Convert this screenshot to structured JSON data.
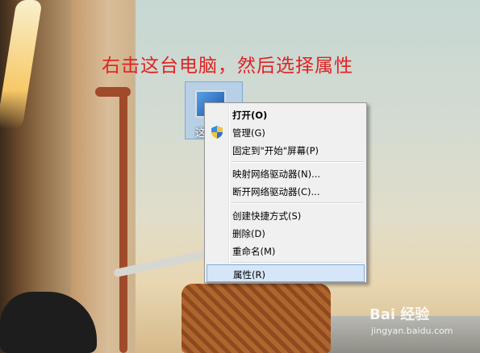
{
  "instruction": "右击这台电脑，然后选择属性",
  "desktop_icon": {
    "label": "这",
    "icon": "computer-monitor-icon"
  },
  "context_menu": {
    "items": [
      {
        "label": "打开(O)",
        "bold": true
      },
      {
        "label": "管理(G)",
        "icon": "uac-shield-icon"
      },
      {
        "label": "固定到\"开始\"屏幕(P)"
      },
      {
        "label": "映射网络驱动器(N)..."
      },
      {
        "label": "断开网络驱动器(C)..."
      },
      {
        "label": "创建快捷方式(S)"
      },
      {
        "label": "删除(D)"
      },
      {
        "label": "重命名(M)"
      },
      {
        "label": "属性(R)",
        "selected": true
      }
    ]
  },
  "watermark": {
    "brand": "Bai 经验",
    "url": "jingyan.baidu.com"
  },
  "colors": {
    "instruction": "#e02222",
    "selection": "#d5e6f8",
    "menu_bg": "#f0f0f0"
  }
}
